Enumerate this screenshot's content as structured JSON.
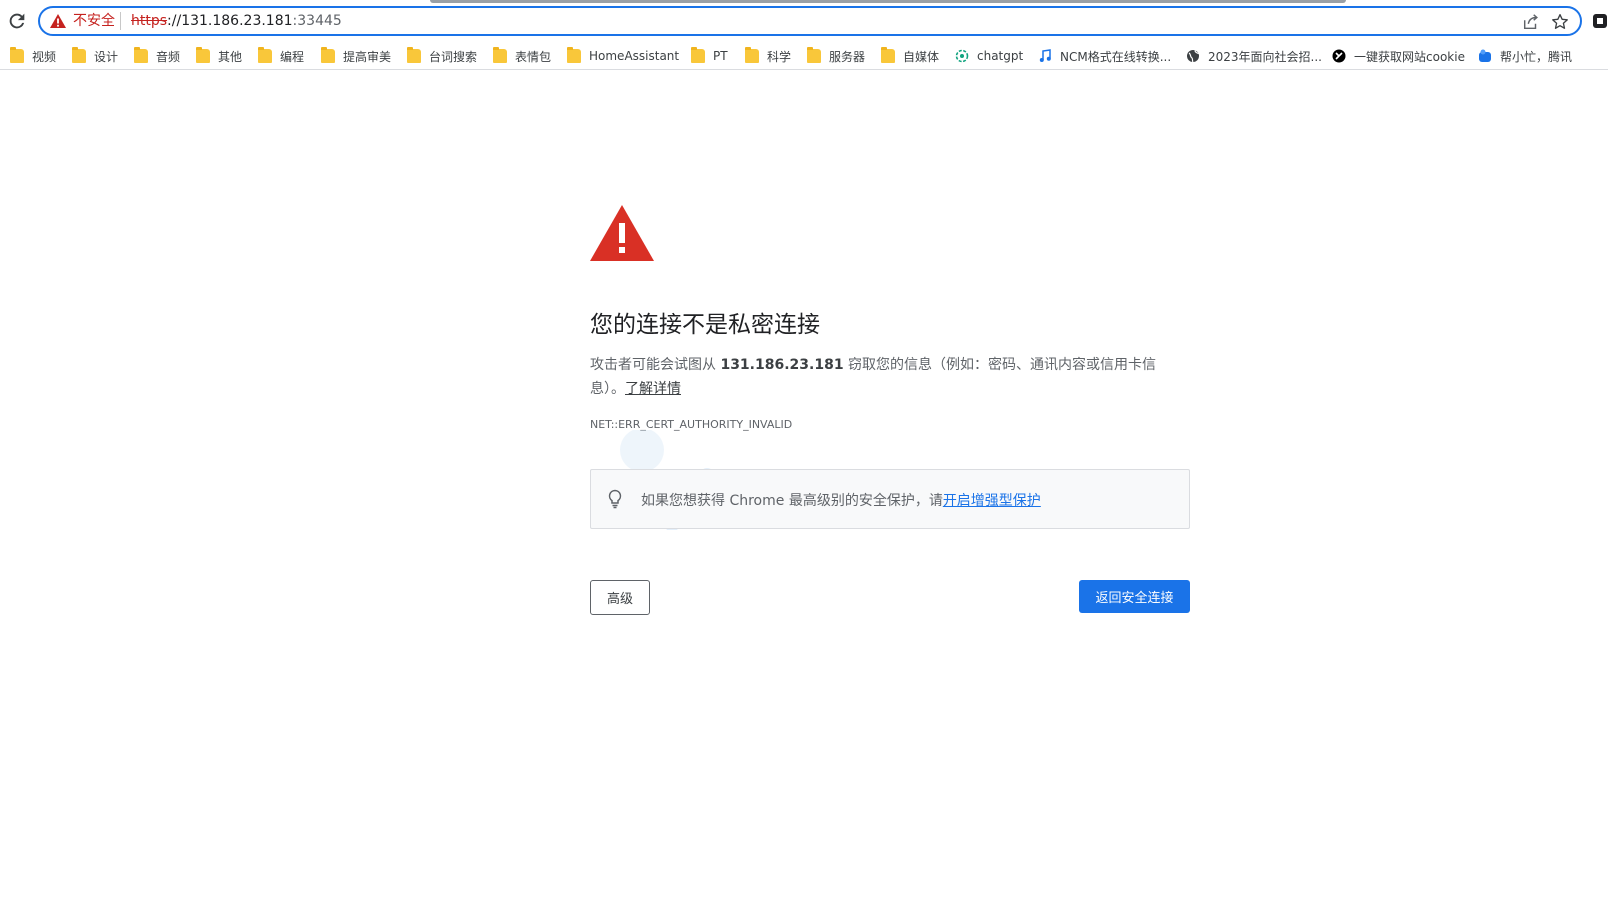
{
  "browser": {
    "security_label": "不安全",
    "url_scheme": "https",
    "url_host": "://131.186.23.181",
    "url_port": ":33445"
  },
  "bookmarks": [
    {
      "label": "视频",
      "icon": "folder-icon"
    },
    {
      "label": "设计",
      "icon": "folder-icon"
    },
    {
      "label": "音频",
      "icon": "folder-icon"
    },
    {
      "label": "其他",
      "icon": "folder-icon"
    },
    {
      "label": "编程",
      "icon": "folder-icon"
    },
    {
      "label": "提高审美",
      "icon": "folder-icon"
    },
    {
      "label": "台词搜索",
      "icon": "folder-icon"
    },
    {
      "label": "表情包",
      "icon": "folder-icon"
    },
    {
      "label": "HomeAssistant",
      "icon": "folder-icon"
    },
    {
      "label": "PT",
      "icon": "folder-icon"
    },
    {
      "label": "科学",
      "icon": "folder-icon"
    },
    {
      "label": "服务器",
      "icon": "folder-icon"
    },
    {
      "label": "自媒体",
      "icon": "folder-icon"
    },
    {
      "label": "chatgpt",
      "icon": "openai-icon"
    },
    {
      "label": "NCM格式在线转换...",
      "icon": "music-note-icon"
    },
    {
      "label": "2023年面向社会招...",
      "icon": "globe-icon"
    },
    {
      "label": "一键获取网站cookie",
      "icon": "cookie-site-icon"
    },
    {
      "label": "帮小忙，腾讯",
      "icon": "tencent-icon"
    }
  ],
  "page": {
    "title": "您的连接不是私密连接",
    "desc_before": "攻击者可能会试图从 ",
    "desc_host": "131.186.23.181",
    "desc_after": " 窃取您的信息（例如：密码、通讯内容或信用卡信息）。",
    "learn_more": "了解详情",
    "error_code": "NET::ERR_CERT_AUTHORITY_INVALID",
    "tip_text": "如果您想获得 Chrome 最高级别的安全保护，请",
    "tip_link": "开启增强型保护",
    "advanced_button": "高级",
    "back_button": "返回安全连接"
  },
  "colors": {
    "accent": "#1a73e8",
    "danger": "#c5221f",
    "warning_triangle": "#d93025",
    "folder": "#f9c73a"
  }
}
